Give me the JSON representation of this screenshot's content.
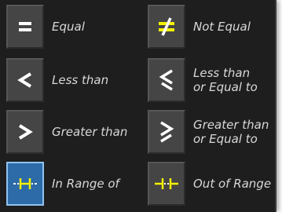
{
  "operators": [
    {
      "label": "Equal",
      "label2": "",
      "icon": "equal-icon",
      "selected": false
    },
    {
      "label": "Not Equal",
      "label2": "",
      "icon": "not-equal-icon",
      "selected": false
    },
    {
      "label": "Less than",
      "label2": "",
      "icon": "less-than-icon",
      "selected": false
    },
    {
      "label": "Less than",
      "label2": "or Equal to",
      "icon": "less-than-or-equal-icon",
      "selected": false
    },
    {
      "label": "Greater than",
      "label2": "",
      "icon": "greater-than-icon",
      "selected": false
    },
    {
      "label": "Greater than",
      "label2": "or Equal to",
      "icon": "greater-than-or-equal-icon",
      "selected": false
    },
    {
      "label": "In Range of",
      "label2": "",
      "icon": "in-range-icon",
      "selected": true
    },
    {
      "label": "Out of Range",
      "label2": "",
      "icon": "out-of-range-icon",
      "selected": false
    }
  ],
  "colors": {
    "panel_bg": "#1e1e1e",
    "button_bg": "#454545",
    "selected_bg": "#2d6aa8",
    "selected_border": "#8fc2ef",
    "text": "#d8d8d8",
    "icon_white": "#ffffff",
    "icon_yellow": "#f2f200"
  }
}
